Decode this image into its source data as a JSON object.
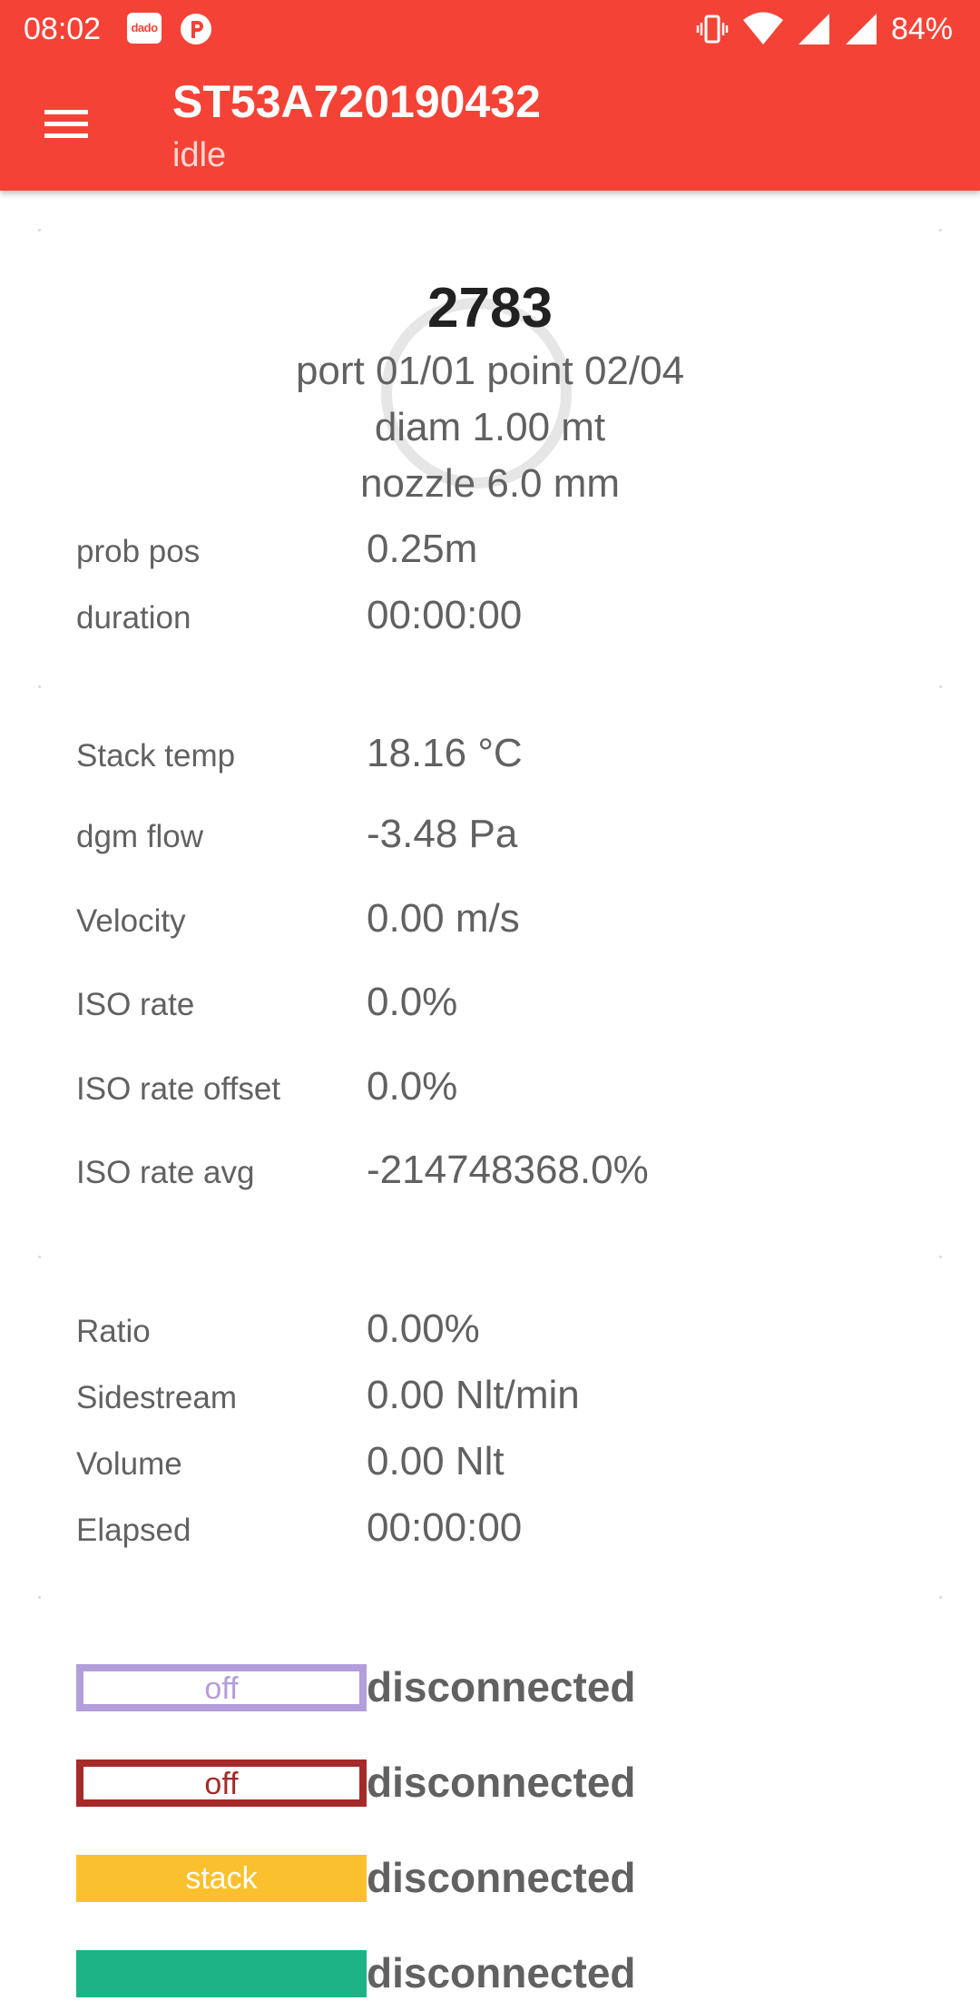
{
  "status_bar": {
    "time": "08:02",
    "notif_dado": "dado",
    "battery": "84%"
  },
  "app_bar": {
    "title": "ST53A720190432",
    "subtitle": "idle"
  },
  "summary": {
    "number": "2783",
    "port_point": "port 01/01 point 02/04",
    "diam": "diam 1.00 mt",
    "nozzle": "nozzle 6.0 mm"
  },
  "position": [
    {
      "label": "prob pos",
      "value": "0.25m"
    },
    {
      "label": "duration",
      "value": "00:00:00"
    }
  ],
  "measurements": [
    {
      "label": "Stack temp",
      "value": "18.16 °C"
    },
    {
      "label": "dgm flow",
      "value": "-3.48 Pa"
    },
    {
      "label": "Velocity",
      "value": "0.00 m/s"
    },
    {
      "label": "ISO rate",
      "value": "0.0%"
    },
    {
      "label": "ISO rate offset",
      "value": "0.0%"
    },
    {
      "label": "ISO rate avg",
      "value": "-214748368.0%"
    }
  ],
  "sampling": [
    {
      "label": "Ratio",
      "value": "0.00%"
    },
    {
      "label": "Sidestream",
      "value": "0.00 Nlt/min"
    },
    {
      "label": "Volume",
      "value": "0.00 Nlt"
    },
    {
      "label": "Elapsed",
      "value": "00:00:00"
    }
  ],
  "devices": [
    {
      "badge": "off",
      "status": "disconnected",
      "color": "#b39ddb"
    },
    {
      "badge": "off",
      "status": "disconnected",
      "color": "#a52a2a"
    },
    {
      "badge": "stack",
      "status": "disconnected",
      "color": "#fbc02d"
    },
    {
      "badge": "",
      "status": "disconnected",
      "color": "#1db386"
    }
  ],
  "colors": {
    "header": "#f44336",
    "text": "#616161"
  }
}
